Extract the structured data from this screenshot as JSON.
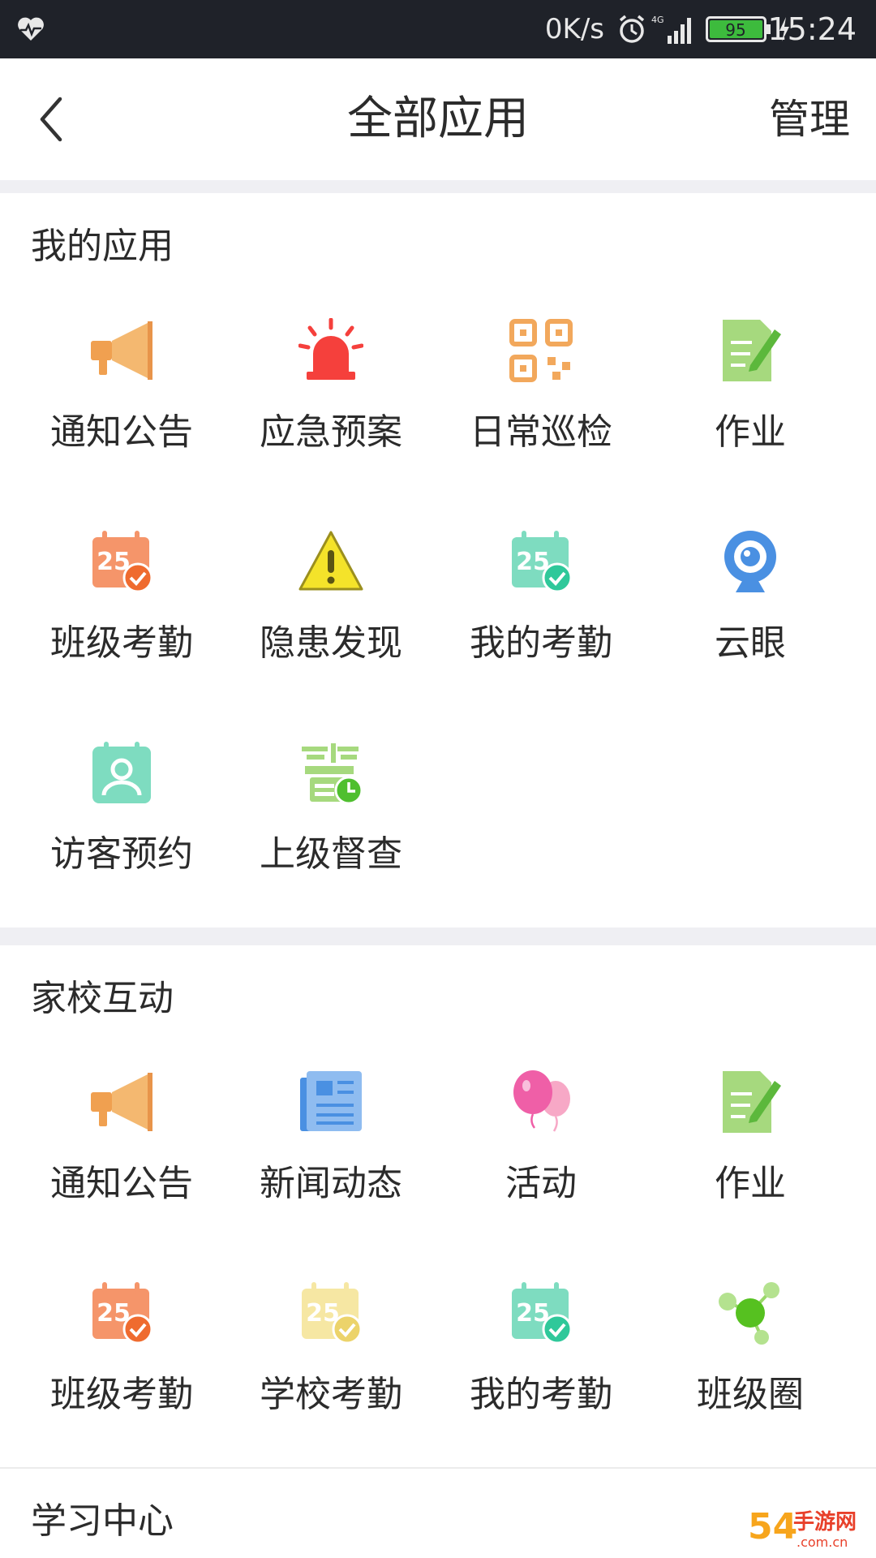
{
  "status_bar": {
    "net_speed": "0K/s",
    "battery_level": "95",
    "time": "15:24",
    "icons": [
      "heart-monitor-icon",
      "alarm-icon",
      "signal-4g-icon",
      "battery-icon",
      "charging-icon"
    ]
  },
  "nav": {
    "title": "全部应用",
    "manage_label": "管理"
  },
  "sections": [
    {
      "title": "我的应用",
      "apps": [
        {
          "label": "通知公告",
          "icon": "megaphone-icon"
        },
        {
          "label": "应急预案",
          "icon": "siren-icon"
        },
        {
          "label": "日常巡检",
          "icon": "qr-code-icon"
        },
        {
          "label": "作业",
          "icon": "homework-icon"
        },
        {
          "label": "班级考勤",
          "icon": "calendar-check-orange-icon"
        },
        {
          "label": "隐患发现",
          "icon": "warning-icon"
        },
        {
          "label": "我的考勤",
          "icon": "calendar-check-teal-icon"
        },
        {
          "label": "云眼",
          "icon": "webcam-icon"
        },
        {
          "label": "访客预约",
          "icon": "visitor-icon"
        },
        {
          "label": "上级督查",
          "icon": "supervise-icon"
        }
      ]
    },
    {
      "title": "家校互动",
      "apps": [
        {
          "label": "通知公告",
          "icon": "megaphone-icon"
        },
        {
          "label": "新闻动态",
          "icon": "newspaper-icon"
        },
        {
          "label": "活动",
          "icon": "balloons-icon"
        },
        {
          "label": "作业",
          "icon": "homework-icon"
        },
        {
          "label": "班级考勤",
          "icon": "calendar-check-orange-icon"
        },
        {
          "label": "学校考勤",
          "icon": "calendar-check-yellow-icon"
        },
        {
          "label": "我的考勤",
          "icon": "calendar-check-teal-icon"
        },
        {
          "label": "班级圈",
          "icon": "class-circle-icon"
        }
      ]
    },
    {
      "title": "学习中心",
      "apps": []
    }
  ],
  "watermark": {
    "brand": "54",
    "text": "手游网",
    "domain": ".com.cn"
  }
}
